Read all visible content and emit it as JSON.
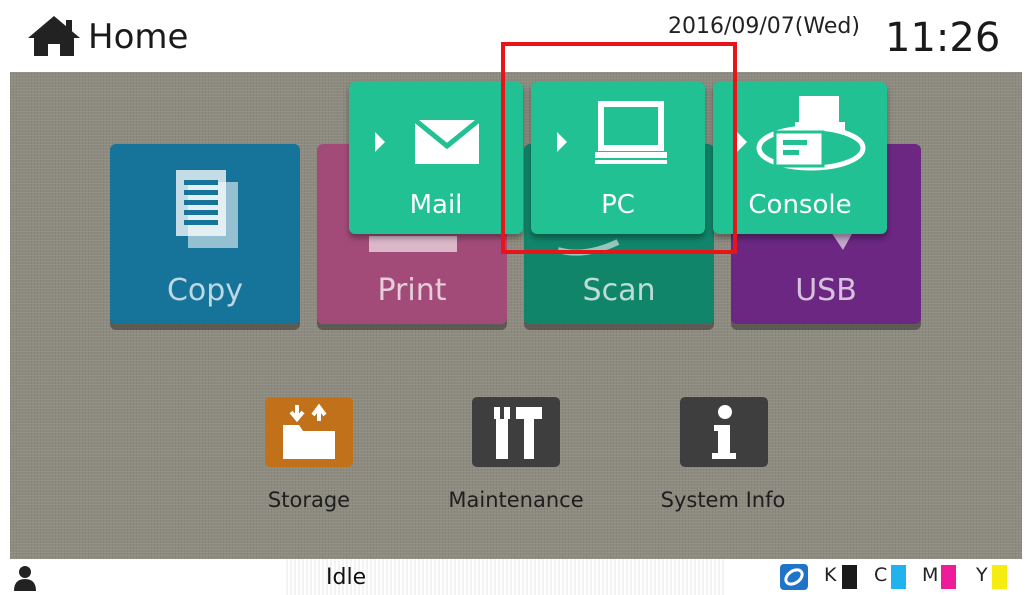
{
  "header": {
    "title": "Home",
    "date": "2016/09/07(Wed)",
    "time": "11:26",
    "home_icon": "home-icon"
  },
  "tiles": [
    {
      "label": "Copy",
      "color": "#16739a",
      "icon": "copy-document-icon"
    },
    {
      "label": "Print",
      "color": "#a24b79",
      "icon": "printer-icon"
    },
    {
      "label": "Scan",
      "color": "#11856a",
      "icon": "scanner-icon"
    },
    {
      "label": "USB",
      "color": "#6b2782",
      "icon": "usb-icon"
    }
  ],
  "scan_popup": {
    "color": "#21c193",
    "items": [
      {
        "label": "Mail",
        "icon": "envelope-icon"
      },
      {
        "label": "PC",
        "icon": "computer-icon"
      },
      {
        "label": "Console",
        "icon": "console-icon"
      }
    ],
    "highlight_color": "#e8141a"
  },
  "small_tiles": [
    {
      "label": "Storage",
      "color": "#c0711a",
      "icon": "storage-folder-icon"
    },
    {
      "label": "Maintenance",
      "color": "#3e3e3e",
      "icon": "tools-icon"
    },
    {
      "label": "System Info",
      "color": "#3e3e3e",
      "icon": "info-icon"
    }
  ],
  "status": {
    "text": "Idle",
    "user_icon": "user-icon",
    "link_icon": "link-icon",
    "inks": [
      {
        "letter": "K",
        "color": "#1a1a1a"
      },
      {
        "letter": "C",
        "color": "#21b3ee"
      },
      {
        "letter": "M",
        "color": "#ee1b9a"
      },
      {
        "letter": "Y",
        "color": "#f5ec12"
      }
    ]
  }
}
